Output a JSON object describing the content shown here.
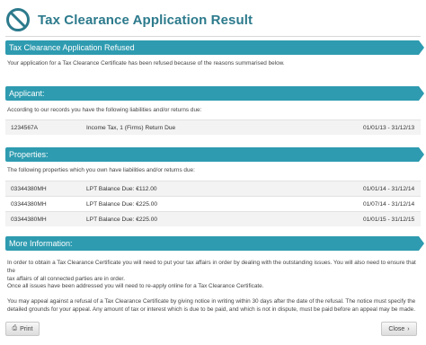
{
  "page": {
    "title": "Tax Clearance Application Result"
  },
  "refused": {
    "heading": "Tax Clearance Application Refused",
    "text": "Your application for a Tax Clearance Certificate has been refused because of the reasons summarised below."
  },
  "applicant": {
    "heading": "Applicant:",
    "text": "According to our records you have the following liabilities and/or returns due:",
    "rows": [
      {
        "ref": "1234567A",
        "desc": "Income Tax, 1 (Firms) Return Due",
        "period": "01/01/13 - 31/12/13"
      }
    ]
  },
  "properties": {
    "heading": "Properties:",
    "text": "The following properties which you own have liabilities and/or returns due:",
    "rows": [
      {
        "ref": "03344380MH",
        "desc": "LPT Balance Due: €112.00",
        "period": "01/01/14 - 31/12/14"
      },
      {
        "ref": "03344380MH",
        "desc": "LPT Balance Due: €225.00",
        "period": "01/07/14 - 31/12/14"
      },
      {
        "ref": "03344380MH",
        "desc": "LPT Balance Due: €225.00",
        "period": "01/01/15 - 31/12/15"
      }
    ]
  },
  "more": {
    "heading": "More Information:",
    "p1_line1": "In order to obtain a Tax Clearance Certificate you will need to put your tax affairs in order by dealing with the outstanding issues. You will also need to ensure that the",
    "p1_line2": "tax affairs of all connected parties are in order.",
    "p2": "Once all issues have been addressed you will need to re-apply online for a Tax Clearance Certificate.",
    "p3_line1": "You may appeal against a refusal of a Tax Clearance Certificate by giving notice in writing within 30 days after the date of the refusal. The notice must specify the",
    "p3_line2": "detailed grounds for your appeal. Any amount of tax or interest which is due to be paid, and which is not in dispute, must be paid before an appeal may be made."
  },
  "buttons": {
    "print": "Print",
    "close": "Close"
  },
  "icons": {
    "header": "prohibited-icon",
    "print": "printer-icon",
    "close": "chevron-right-icon"
  },
  "colors": {
    "accent": "#2e9bb0",
    "title": "#2c7a8c"
  }
}
